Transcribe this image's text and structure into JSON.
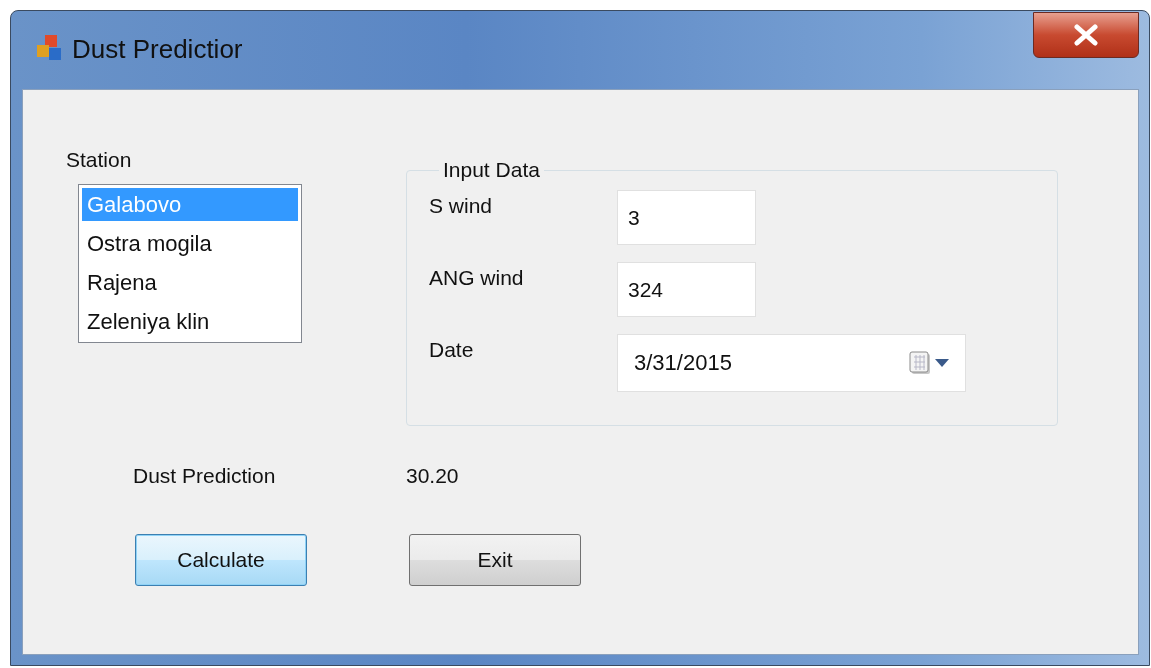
{
  "window": {
    "title": "Dust Predictior"
  },
  "station": {
    "label": "Station",
    "items": [
      {
        "label": "Galabovo",
        "selected": true
      },
      {
        "label": "Ostra mogila",
        "selected": false
      },
      {
        "label": "Rajena",
        "selected": false
      },
      {
        "label": "Zeleniya klin",
        "selected": false
      }
    ]
  },
  "input_data": {
    "title": "Input Data",
    "fields": [
      {
        "kind": "text",
        "label": "S wind",
        "value": "3"
      },
      {
        "kind": "text",
        "label": "ANG wind",
        "value": "324"
      },
      {
        "kind": "date",
        "label": "Date",
        "value": "3/31/2015"
      }
    ]
  },
  "result": {
    "label": "Dust Prediction",
    "value": "30.20"
  },
  "buttons": [
    {
      "label": "Calculate",
      "focused": true
    },
    {
      "label": "Exit",
      "focused": false
    }
  ]
}
